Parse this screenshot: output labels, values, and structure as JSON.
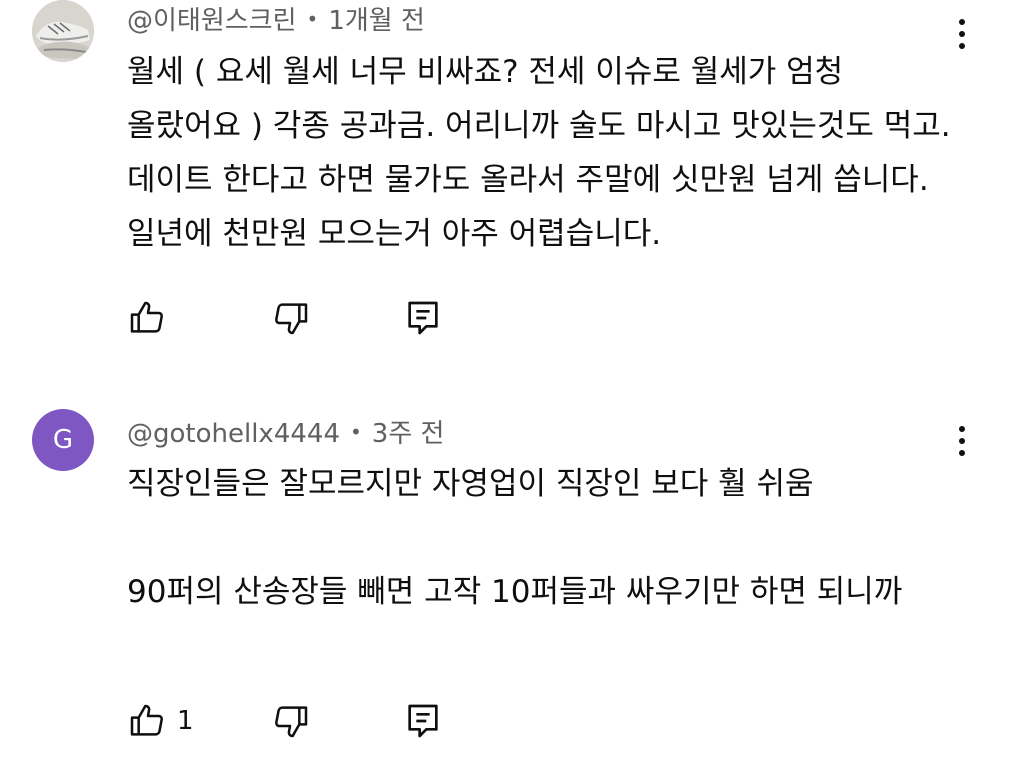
{
  "comments": [
    {
      "handle": "@이태원스크린",
      "time": "1개월 전",
      "avatar": {
        "kind": "photo",
        "icon": "sneakers-photo"
      },
      "text": "월세 ( 요세 월세 너무 비싸죠? 전세 이슈로 월세가 엄청 올랐어요 ) 각종 공과금. 어리니까 술도 마시고 맛있는것도 먹고. 데이트 한다고 하면 물가도 올라서 주말에 싯만원 넘게 씁니다. 일년에 천만원 모으는거 아주 어렵습니다.",
      "likes": ""
    },
    {
      "handle": "@gotohellx4444",
      "time": "3주 전",
      "avatar": {
        "kind": "letter",
        "letter": "G",
        "color": "#7e57c2"
      },
      "text": "직장인들은 잘모르지만 자영업이 직장인 보다 훨 쉬움\n\n90퍼의 산송장들 빼면 고작 10퍼들과 싸우기만 하면 되니까",
      "likes": "1"
    }
  ],
  "separator": "•",
  "icons": {
    "like": "thumbs-up-icon",
    "dislike": "thumbs-down-icon",
    "reply": "reply-icon",
    "more": "more-vertical-icon"
  }
}
